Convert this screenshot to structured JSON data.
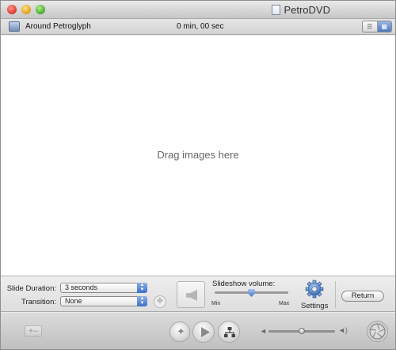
{
  "window": {
    "title": "PetroDVD"
  },
  "project": {
    "name": "Around Petroglyph",
    "duration": "0 min, 00 sec"
  },
  "drop_area": {
    "hint": "Drag images here"
  },
  "slideshow_settings": {
    "slide_duration_label": "Slide Duration:",
    "slide_duration_value": "3 seconds",
    "transition_label": "Transition:",
    "transition_value": "None",
    "volume_label": "Slideshow volume:",
    "volume_min_label": "Min",
    "volume_max_label": "Max",
    "volume_level": 0.5,
    "settings_label": "Settings",
    "return_label": "Return"
  },
  "playback": {
    "volume_level": 0.5
  },
  "icons": {
    "project": "slideshow-icon",
    "list_view": "list-view-icon",
    "thumb_view": "grid-view-icon",
    "audio_well": "speaker-icon",
    "gear": "gear-icon",
    "add": "add-icon",
    "motion": "motion-icon",
    "play": "play-icon",
    "map": "map-icon",
    "burn": "burn-icon"
  },
  "colors": {
    "accent": "#3c6fc7",
    "titlebar_top": "#e9e9e9",
    "titlebar_bottom": "#c7c7c7",
    "drop_area": "#ffffff"
  }
}
